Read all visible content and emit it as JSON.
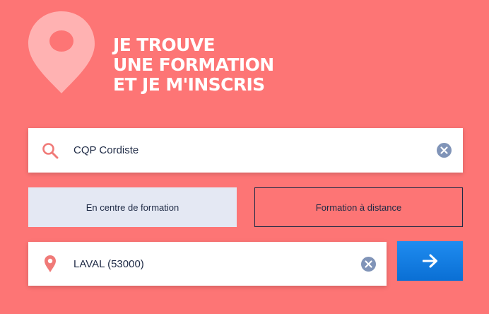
{
  "hero": {
    "title_lines": [
      "JE TROUVE",
      "UNE FORMATION",
      "ET JE M'INSCRIS"
    ],
    "icon": "map-pin-icon"
  },
  "search": {
    "value": "CQP Cordiste",
    "icon": "search-icon",
    "clear_icon": "close-circle-icon"
  },
  "modes": {
    "on_site_label": "En centre de formation",
    "remote_label": "Formation à distance",
    "selected": "on_site"
  },
  "location": {
    "value": "LAVAL (53000)",
    "icon": "location-pin-icon",
    "clear_icon": "close-circle-icon"
  },
  "submit": {
    "icon": "arrow-right-icon"
  },
  "colors": {
    "background": "#fd7575",
    "hero_pin": "#ffb2b2",
    "accent_icon": "#f07a78",
    "selected_mode_bg": "#e4e8f3",
    "text_dark": "#1e2a45",
    "clear_icon_bg": "#8094b8",
    "submit_bg": "#1080e6"
  }
}
